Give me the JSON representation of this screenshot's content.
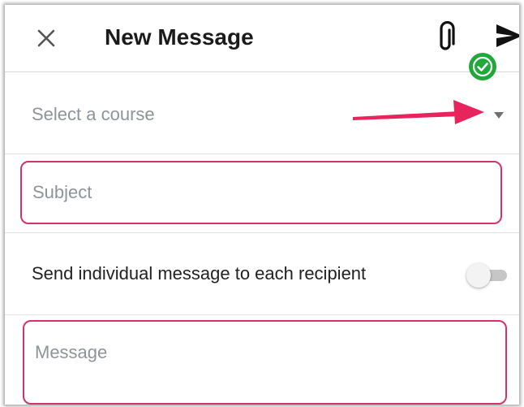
{
  "header": {
    "title": "New Message",
    "close_icon": "close-icon",
    "attach_icon": "paperclip-icon",
    "send_icon": "send-icon",
    "badge_icon": "check-circle-icon"
  },
  "course": {
    "label": "Select a course",
    "caret_icon": "caret-down-icon"
  },
  "subject": {
    "placeholder": "Subject"
  },
  "individual": {
    "label": "Send individual message to each recipient",
    "enabled": false
  },
  "message": {
    "placeholder": "Message"
  },
  "colors": {
    "highlight": "#d2336b",
    "arrow": "#e8245c",
    "badge": "#20a83a",
    "text": "#1b1b1b",
    "placeholder": "#8f9498"
  }
}
